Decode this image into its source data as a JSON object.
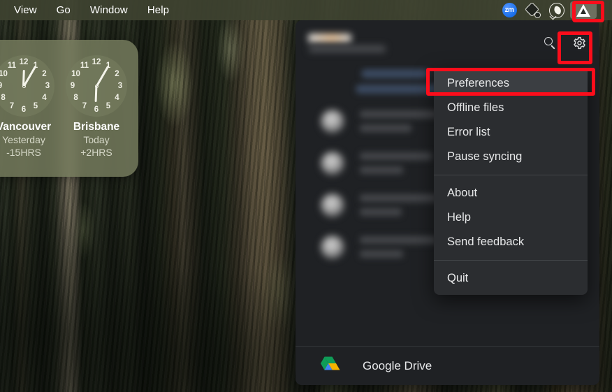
{
  "menubar": {
    "menus": [
      "View",
      "Go",
      "Window",
      "Help"
    ],
    "status_icons": [
      {
        "name": "zoom-icon",
        "label": "zm"
      },
      {
        "name": "shape-diamond-icon",
        "label": ""
      },
      {
        "name": "phone-bubble-icon",
        "label": ""
      },
      {
        "name": "google-drive-menubar-icon",
        "label": ""
      }
    ]
  },
  "clock_widget": {
    "clocks": [
      {
        "city": "Vancouver",
        "day": "Yesterday",
        "offset": "-15HRS",
        "hour_deg": 2,
        "minute_deg": 30
      },
      {
        "city": "Brisbane",
        "day": "Today",
        "offset": "+2HRS",
        "hour_deg": 182,
        "minute_deg": 30
      }
    ],
    "numerals": [
      "12",
      "1",
      "2",
      "3",
      "4",
      "5",
      "6",
      "7",
      "8",
      "9",
      "10",
      "11"
    ]
  },
  "drive_panel": {
    "header": {
      "account_name_redacted": "",
      "account_email_redacted": "",
      "search_icon": "search-icon",
      "settings_icon": "gear-icon"
    },
    "footer": {
      "app_label": "Google Drive",
      "app_icon": "google-drive-color-icon"
    },
    "file_rows": [
      {
        "line1_width": 88,
        "line2_width": 66,
        "line3_width": 74
      },
      {
        "line1_width": 104,
        "line2_width": 62,
        "line3_width": 0
      },
      {
        "line1_width": 118,
        "line2_width": 60,
        "line3_width": 0
      },
      {
        "line1_width": 112,
        "line2_width": 62,
        "line3_width": 0
      }
    ]
  },
  "gear_menu": {
    "items": [
      {
        "label": "Preferences",
        "highlighted": true
      },
      {
        "label": "Offline files",
        "highlighted": false
      },
      {
        "label": "Error list",
        "highlighted": false
      },
      {
        "label": "Pause syncing",
        "highlighted": false
      },
      {
        "separator": true
      },
      {
        "label": "About",
        "highlighted": false
      },
      {
        "label": "Help",
        "highlighted": false
      },
      {
        "label": "Send feedback",
        "highlighted": false
      },
      {
        "separator": true
      },
      {
        "label": "Quit",
        "highlighted": false
      }
    ]
  },
  "annotations": {
    "highlight_color": "#fc0d1b",
    "boxes": [
      "menubar-drive-icon",
      "gear-icon",
      "preferences-menu-item"
    ]
  }
}
